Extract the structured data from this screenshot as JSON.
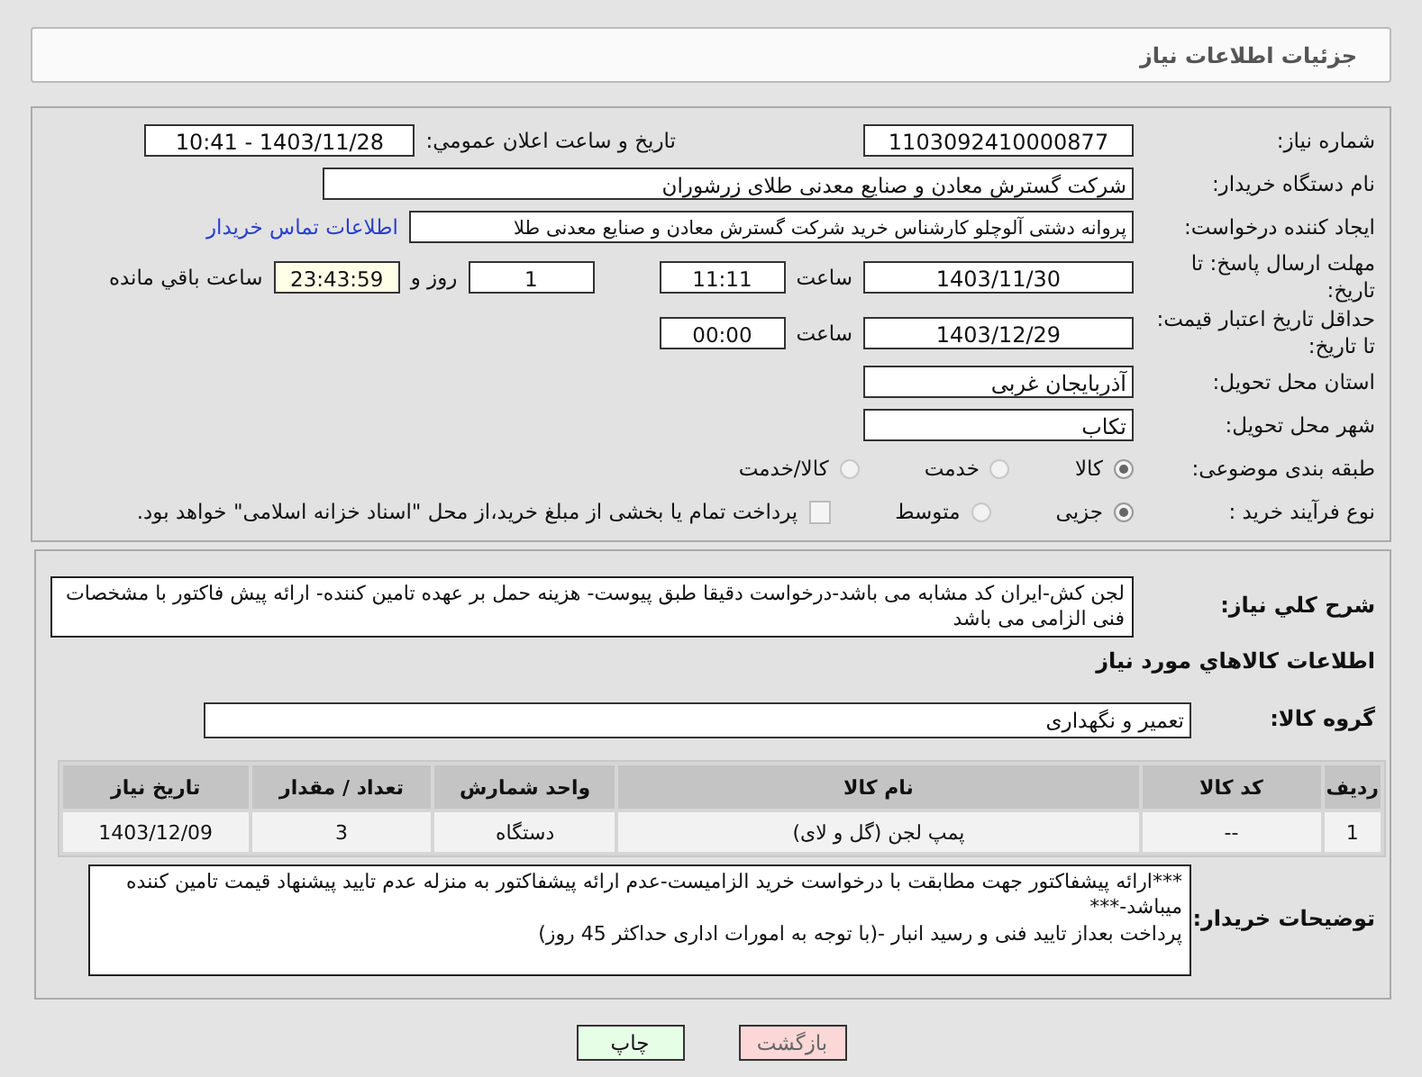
{
  "header": {
    "title": "جزئیات اطلاعات نیاز"
  },
  "need_number": {
    "label": "شماره نیاز:",
    "value": "1103092410000877"
  },
  "announce": {
    "label": "تاریخ و ساعت اعلان عمومي:",
    "value": "1403/11/28 - 10:41"
  },
  "buyer": {
    "label": "نام دستگاه خریدار:",
    "value": "شرکت گسترش معادن و صنایع معدنی طلای زرشوران"
  },
  "requester": {
    "label": "ایجاد کننده درخواست:",
    "value": "پروانه  دشتی آلوچلو کارشناس خرید شرکت گسترش معادن و صنایع معدنی طلا",
    "link": "اطلاعات تماس خریدار"
  },
  "deadline": {
    "label": "مهلت ارسال پاسخ: تا تاریخ:",
    "date": "1403/11/30",
    "time_label": "ساعت",
    "time": "11:11",
    "days": "1",
    "days_label": "روز و",
    "remaining": "23:43:59",
    "remaining_label": "ساعت باقي مانده"
  },
  "validity": {
    "label": "حداقل تاریخ اعتبار قیمت: تا تاریخ:",
    "date": "1403/12/29",
    "time_label": "ساعت",
    "time": "00:00"
  },
  "province": {
    "label": "استان محل تحویل:",
    "value": "آذربایجان غربی"
  },
  "city": {
    "label": "شهر محل تحویل:",
    "value": "تکاب"
  },
  "category": {
    "label": "طبقه بندی موضوعی:",
    "options": [
      {
        "label": "کالا",
        "selected": true
      },
      {
        "label": "خدمت",
        "selected": false
      },
      {
        "label": "کالا/خدمت",
        "selected": false
      }
    ]
  },
  "process": {
    "label": "نوع فرآیند خرید :",
    "options": [
      {
        "label": "جزیی",
        "selected": true
      },
      {
        "label": "متوسط",
        "selected": false
      }
    ],
    "treasury": {
      "label": "پرداخت تمام یا بخشی از مبلغ خرید،از محل \"اسناد خزانه اسلامی\" خواهد بود.",
      "checked": false
    }
  },
  "description": {
    "label": "شرح کلي نیاز:",
    "value": "لجن کش-ایران کد مشابه می باشد-درخواست دقیقا طبق پیوست- هزینه حمل بر عهده تامین کننده- ارائه پیش فاکتور با مشخصات فنی الزامی می باشد"
  },
  "goods_heading": "اطلاعات کالاهاي مورد نياز",
  "goods_group": {
    "label": "گروه کالا:",
    "value": "تعمیر و نگهداری"
  },
  "table": {
    "columns": [
      "ردیف",
      "کد کالا",
      "نام کالا",
      "واحد شمارش",
      "تعداد / مقدار",
      "تاریخ نیاز"
    ],
    "rows": [
      [
        "1",
        "--",
        "پمپ لجن (گل و لای)",
        "دستگاه",
        "3",
        "1403/12/09"
      ]
    ]
  },
  "buyer_notes": {
    "label": "توضیحات خریدار:",
    "lines": [
      "***ارائه پیشفاکتور جهت مطابقت با درخواست خرید الزامیست-عدم ارائه پیشفاکتور به منزله عدم تایید پیشنهاد قیمت تامین کننده میباشد-***",
      "پرداخت بعداز تایید فنی و رسید انبار -(با توجه به امورات اداری حداکثر 45 روز)"
    ]
  },
  "buttons": [
    {
      "label": "بازگشت",
      "kind": "back"
    },
    {
      "label": "چاپ",
      "kind": "print"
    }
  ]
}
